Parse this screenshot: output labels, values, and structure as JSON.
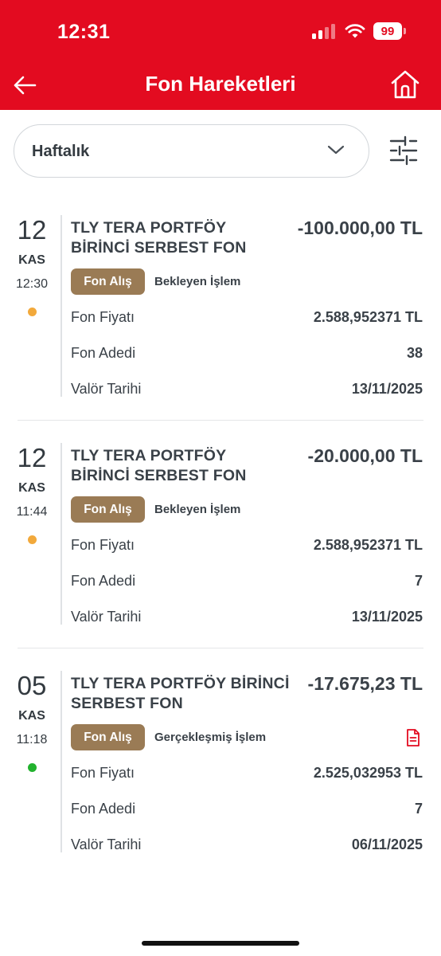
{
  "status_bar": {
    "time": "12:31",
    "battery": "99",
    "icons": [
      "cellular-signal-icon",
      "wifi-icon",
      "battery-icon"
    ]
  },
  "header": {
    "title": "Fon Hareketleri",
    "back_icon": "arrow-left-icon",
    "home_icon": "home-icon",
    "color": "#e30b20"
  },
  "filter": {
    "selected_period": "Haftalık",
    "dropdown_icon": "chevron-down-icon",
    "filter_icon": "sliders-icon"
  },
  "labels": {
    "price": "Fon Fiyatı",
    "quantity": "Fon Adedi",
    "value_date": "Valör Tarihi"
  },
  "transactions": [
    {
      "day": "12",
      "month": "KAS",
      "time": "12:30",
      "fund_name_line1": "TLY TERA PORTFÖY",
      "fund_name_line2": "BİRİNCİ SERBEST FON",
      "amount": "-100.000,00 TL",
      "type": "Fon Alış",
      "status": "Bekleyen İşlem",
      "status_color": "#f2a93b",
      "price": "2.588,952371 TL",
      "quantity": "38",
      "value_date": "13/11/2025"
    },
    {
      "day": "12",
      "month": "KAS",
      "time": "11:44",
      "fund_name_line1": "TLY TERA PORTFÖY",
      "fund_name_line2": "BİRİNCİ SERBEST FON",
      "amount": "-20.000,00 TL",
      "type": "Fon Alış",
      "status": "Bekleyen İşlem",
      "status_color": "#f2a93b",
      "price": "2.588,952371 TL",
      "quantity": "7",
      "value_date": "13/11/2025"
    },
    {
      "day": "05",
      "month": "KAS",
      "time": "11:18",
      "fund_name_line1": "TLY TERA PORTFÖY BİRİNCİ",
      "fund_name_line2": "SERBEST FON",
      "amount": "-17.675,23 TL",
      "type": "Fon Alış",
      "status": "Gerçekleşmiş İşlem",
      "status_color": "#22b22e",
      "document_icon": "document-icon",
      "price": "2.525,032953 TL",
      "quantity": "7",
      "value_date": "06/11/2025"
    }
  ],
  "colors": {
    "badge": "#9a7b55",
    "document_icon": "#e30b20"
  }
}
